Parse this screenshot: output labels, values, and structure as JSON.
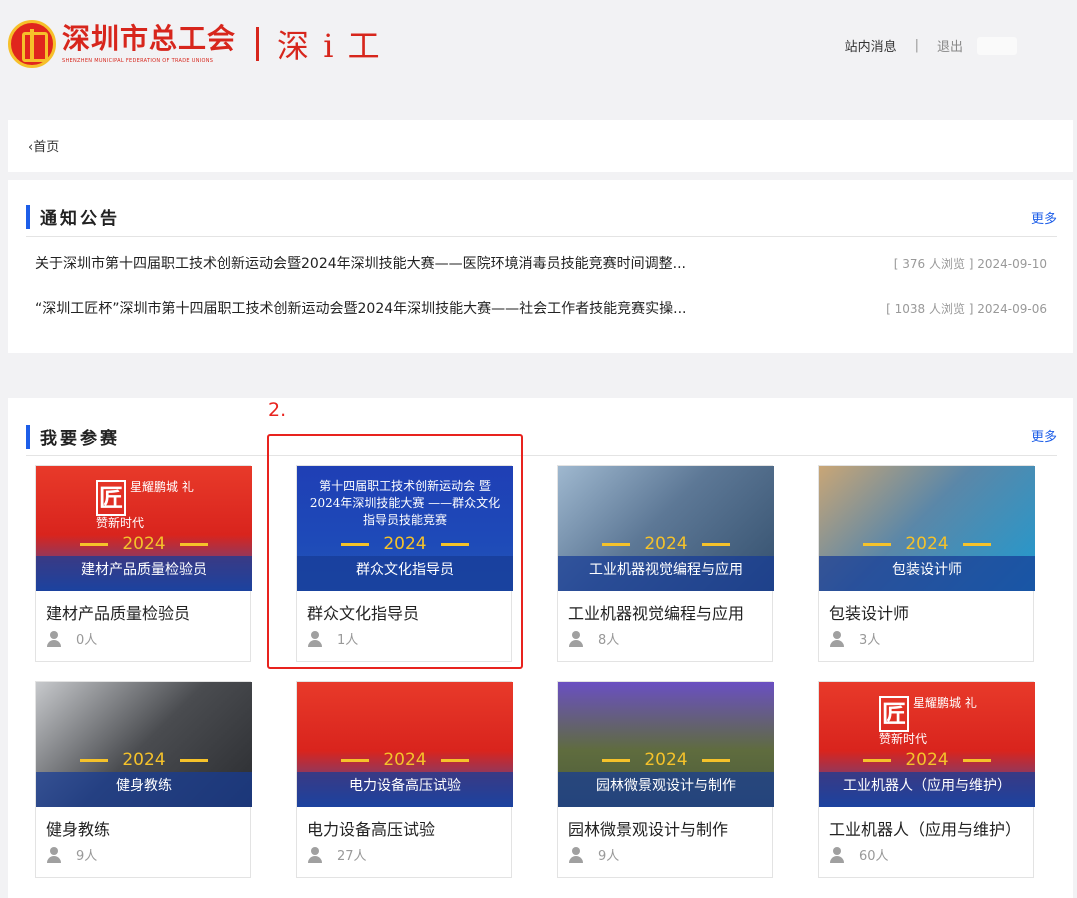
{
  "header": {
    "org_name": "深圳市总工会",
    "org_english": "SHENZHEN MUNICIPAL FEDERATION OF TRADE UNIONS",
    "brand": "深 i 工",
    "nav": {
      "messages": "站内消息",
      "separator": "|",
      "logout": "退出"
    }
  },
  "breadcrumb": {
    "home": "首页"
  },
  "notices": {
    "title": "通知公告",
    "more": "更多",
    "items": [
      {
        "title": "关于深圳市第十四届职工技术创新运动会暨2024年深圳技能大赛——医院环境消毒员技能竞赛时间调整...",
        "meta": "[ 376 人浏览 ] 2024-09-10"
      },
      {
        "title": "“深圳工匠杯”深圳市第十四届职工技术创新运动会暨2024年深圳技能大赛——社会工作者技能竞赛实操...",
        "meta": "[ 1038 人浏览 ] 2024-09-06"
      }
    ]
  },
  "contests": {
    "title": "我要参赛",
    "more": "更多",
    "items": [
      {
        "name": "建材产品质量检验员",
        "count": "0人",
        "year": "2024",
        "banner_label": "建材产品质量检验员",
        "banner_text": "",
        "hero_text": "星耀鹏城 礼赞新时代",
        "bg": "linear-gradient(180deg,#e83a2a 0%,#d9241d 55%,#2a55b8 100%)"
      },
      {
        "name": "群众文化指导员",
        "count": "1人",
        "year": "2024",
        "banner_label": "群众文化指导员",
        "banner_text": "第十四届职工技术创新运动会 暨2024年深圳技能大赛 ——群众文化指导员技能竞赛",
        "hero_text": "",
        "bg": "linear-gradient(180deg,#1f3fb5 0%,#1e4ab8 60%,#2356b8 100%)"
      },
      {
        "name": "工业机器视觉编程与应用",
        "count": "8人",
        "year": "2024",
        "banner_label": "工业机器视觉编程与应用",
        "banner_text": "",
        "hero_text": "",
        "bg": "linear-gradient(135deg,#9fb8cf 0%,#5d7896 45%,#34506e 100%)"
      },
      {
        "name": "包装设计师",
        "count": "3人",
        "year": "2024",
        "banner_label": "包装设计师",
        "banner_text": "",
        "hero_text": "",
        "bg": "linear-gradient(135deg,#c9a676 0%,#5b87a8 45%,#1f9ad0 100%)"
      },
      {
        "name": "健身教练",
        "count": "9人",
        "year": "2024",
        "banner_label": "健身教练",
        "banner_text": "",
        "hero_text": "",
        "bg": "linear-gradient(135deg,#c7c9cc 0%,#4a4c50 50%,#2a2c30 100%)"
      },
      {
        "name": "电力设备高压试验",
        "count": "27人",
        "year": "2024",
        "banner_label": "电力设备高压试验",
        "banner_text": "",
        "hero_text": "",
        "bg": "linear-gradient(180deg,#e83a2a 0%,#d9241d 55%,#2a55b8 100%)"
      },
      {
        "name": "园林微景观设计与制作",
        "count": "9人",
        "year": "2024",
        "banner_label": "园林微景观设计与制作",
        "banner_text": "",
        "hero_text": "",
        "bg": "linear-gradient(180deg,#6a4fc2 0%,#5f6c3e 55%,#4a5a3a 100%)"
      },
      {
        "name": "工业机器人（应用与维护）",
        "count": "60人",
        "year": "2024",
        "banner_label": "工业机器人（应用与维护）",
        "banner_text": "",
        "hero_text": "星耀鹏城 礼赞新时代",
        "bg": "linear-gradient(180deg,#e83a2a 0%,#d9241d 55%,#2a55b8 100%)"
      }
    ]
  },
  "annotation": {
    "label": "2."
  },
  "colors": {
    "accent": "#1d5ee8",
    "brand_red": "#d7261c",
    "annotation_red": "#e8231e"
  }
}
